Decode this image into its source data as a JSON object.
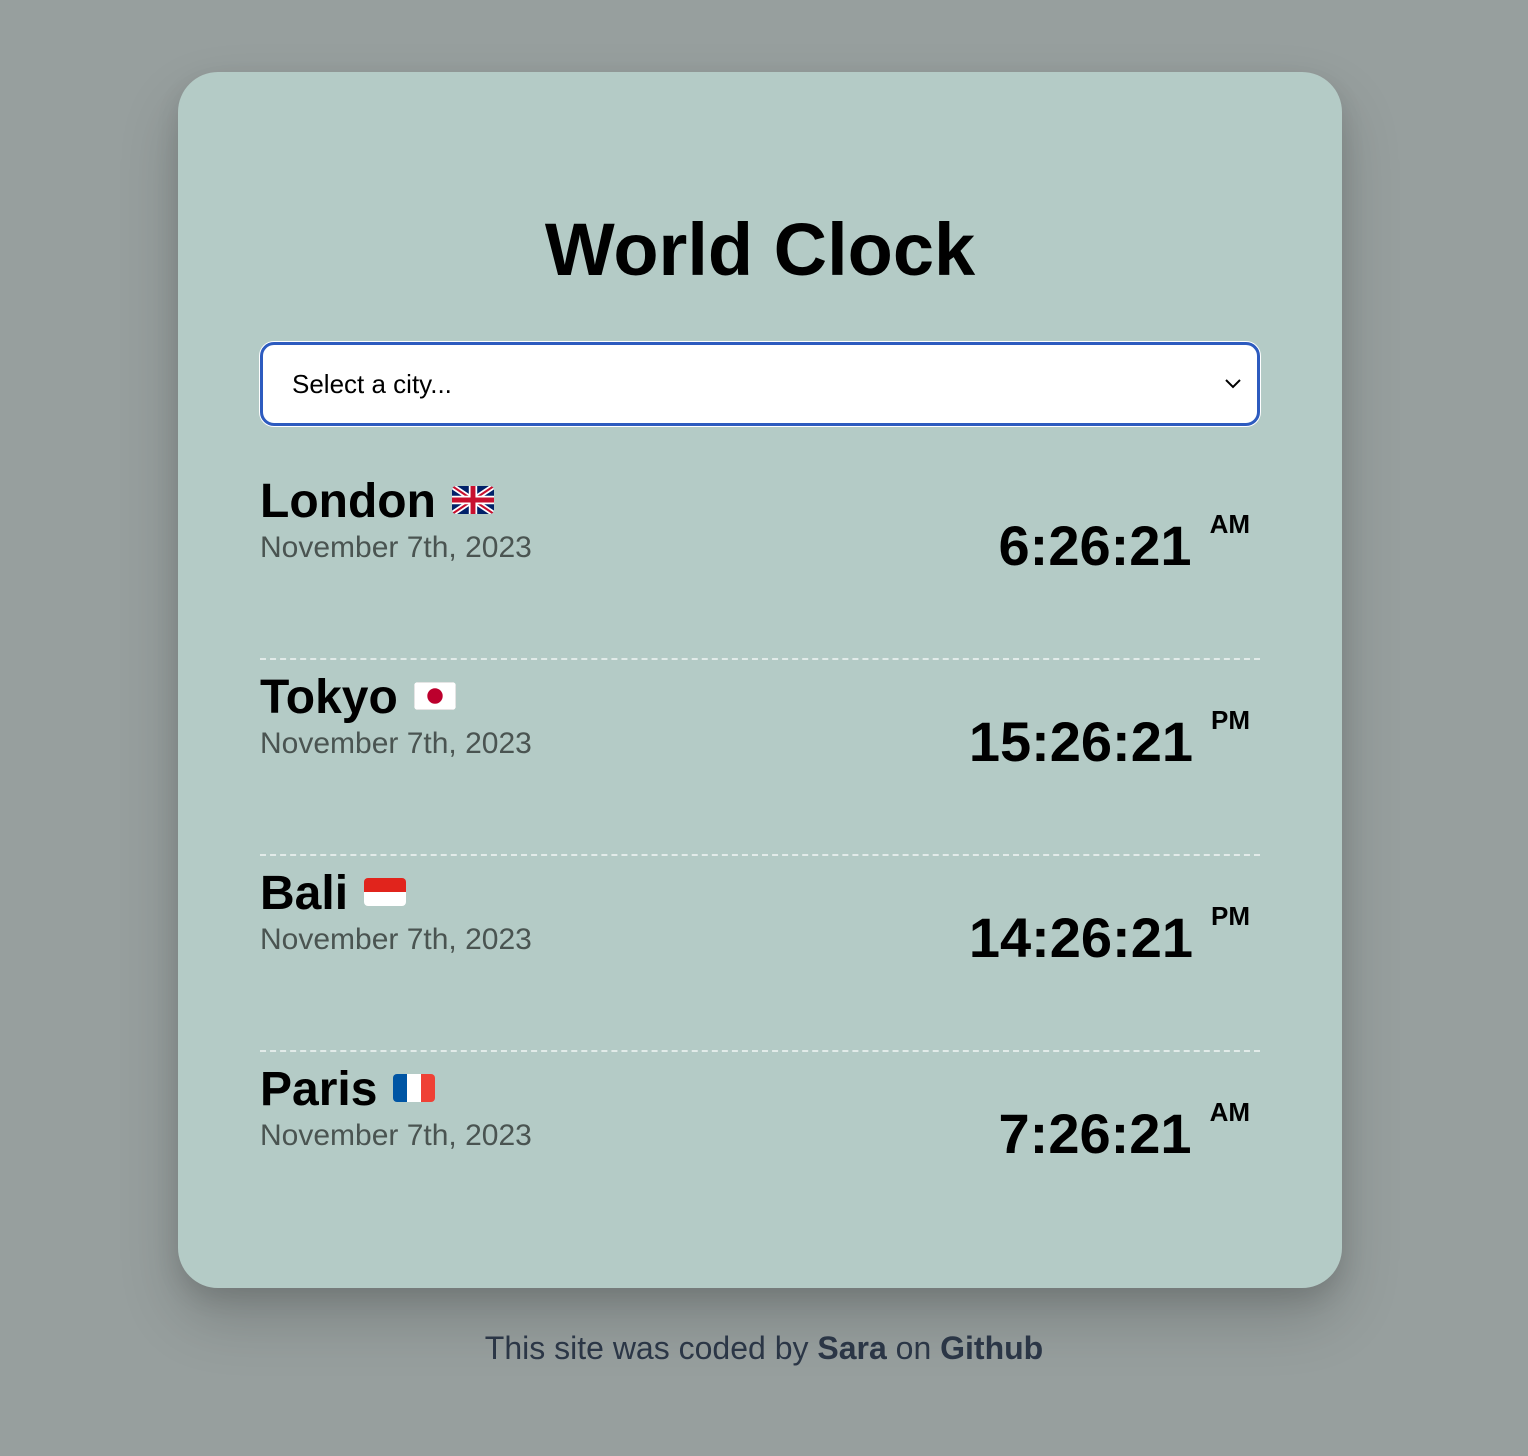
{
  "app": {
    "title": "World Clock"
  },
  "select": {
    "value": "Select a city..."
  },
  "cities": [
    {
      "name": "London",
      "flag": "uk-flag-icon",
      "date": "November 7th, 2023",
      "time": "6:26:21",
      "ampm": "AM"
    },
    {
      "name": "Tokyo",
      "flag": "japan-flag-icon",
      "date": "November 7th, 2023",
      "time": "15:26:21",
      "ampm": "PM"
    },
    {
      "name": "Bali",
      "flag": "indonesia-flag-icon",
      "date": "November 7th, 2023",
      "time": "14:26:21",
      "ampm": "PM"
    },
    {
      "name": "Paris",
      "flag": "france-flag-icon",
      "date": "November 7th, 2023",
      "time": "7:26:21",
      "ampm": "AM"
    }
  ],
  "footer": {
    "prefix": "This site was coded by ",
    "author": "Sara",
    "middle": " on ",
    "link": "Github"
  },
  "colors": {
    "page_background": "#979f9e",
    "card_background": "#b4cbc6",
    "select_border": "#2d5bbf",
    "footer_text": "#2b3646"
  }
}
